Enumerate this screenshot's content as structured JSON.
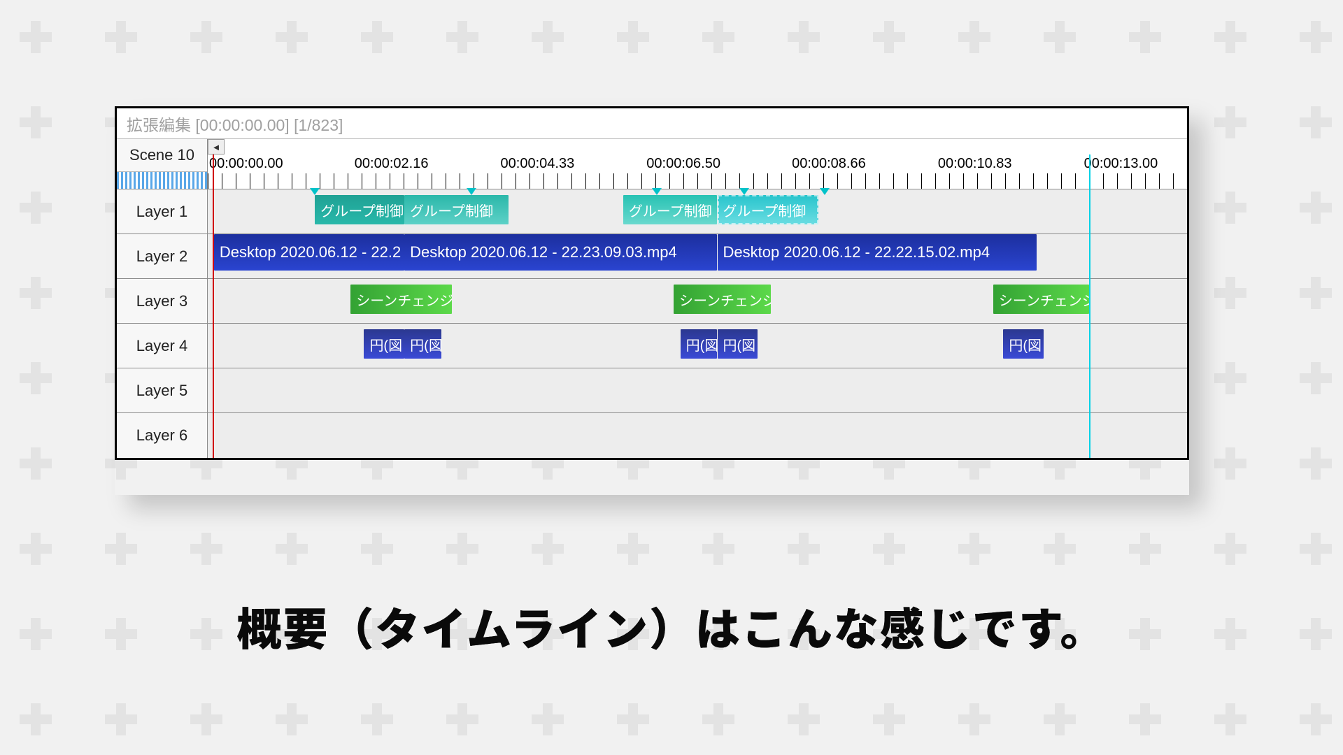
{
  "window": {
    "title": "拡張編集 [00:00:00.00] [1/823]"
  },
  "scene": {
    "label": "Scene 10"
  },
  "ruler": {
    "pxPerSecond": 96.2,
    "labels": [
      {
        "t": 0.0,
        "text": "00:00:00.00"
      },
      {
        "t": 2.16,
        "text": "00:00:02.16"
      },
      {
        "t": 4.33,
        "text": "00:00:04.33"
      },
      {
        "t": 6.5,
        "text": "00:00:06.50"
      },
      {
        "t": 8.66,
        "text": "00:00:08.66"
      },
      {
        "t": 10.83,
        "text": "00:00:10.83"
      },
      {
        "t": 13.0,
        "text": "00:00:13.00"
      }
    ],
    "markers_t": [
      1.52,
      3.85,
      6.6,
      7.9,
      9.1
    ],
    "playhead_t": 0.0,
    "guide_t": 13.02
  },
  "layers": [
    {
      "name": "Layer 1",
      "clips": [
        {
          "label": "グループ制御",
          "start": 1.52,
          "end": 2.85,
          "style": "teal"
        },
        {
          "label": "グループ制御",
          "start": 2.85,
          "end": 4.4,
          "style": "teal-light"
        },
        {
          "label": "グループ制御",
          "start": 6.1,
          "end": 7.5,
          "style": "teal-bright"
        },
        {
          "label": "グループ制御",
          "start": 7.5,
          "end": 9.0,
          "style": "teal-sel"
        }
      ]
    },
    {
      "name": "Layer 2",
      "clips": [
        {
          "label": "Desktop 2020.06.12 - 22.2",
          "start": 0.02,
          "end": 2.85,
          "style": "blue",
          "large": true
        },
        {
          "label": "Desktop 2020.06.12 - 22.23.09.03.mp4",
          "start": 2.85,
          "end": 7.5,
          "style": "blue",
          "large": true
        },
        {
          "label": "Desktop 2020.06.12 - 22.22.15.02.mp4",
          "start": 7.5,
          "end": 12.25,
          "style": "blue",
          "large": true
        }
      ]
    },
    {
      "name": "Layer 3",
      "clips": [
        {
          "label": "シーンチェンジ",
          "start": 2.05,
          "end": 3.55,
          "style": "green"
        },
        {
          "label": "シーンチェンジ",
          "start": 6.85,
          "end": 8.3,
          "style": "green"
        },
        {
          "label": "シーンチェンジ",
          "start": 11.6,
          "end": 13.03,
          "style": "green"
        }
      ]
    },
    {
      "name": "Layer 4",
      "clips": [
        {
          "label": "円(図",
          "start": 2.25,
          "end": 2.85,
          "style": "indigo"
        },
        {
          "label": "円(図",
          "start": 2.85,
          "end": 3.4,
          "style": "indigo"
        },
        {
          "label": "円(図",
          "start": 6.95,
          "end": 7.5,
          "style": "indigo"
        },
        {
          "label": "円(図",
          "start": 7.5,
          "end": 8.1,
          "style": "indigo"
        },
        {
          "label": "円(図",
          "start": 11.75,
          "end": 12.35,
          "style": "indigo"
        }
      ]
    },
    {
      "name": "Layer 5",
      "clips": []
    },
    {
      "name": "Layer 6",
      "clips": []
    }
  ],
  "caption": "概要（タイムライン）はこんな感じです。"
}
